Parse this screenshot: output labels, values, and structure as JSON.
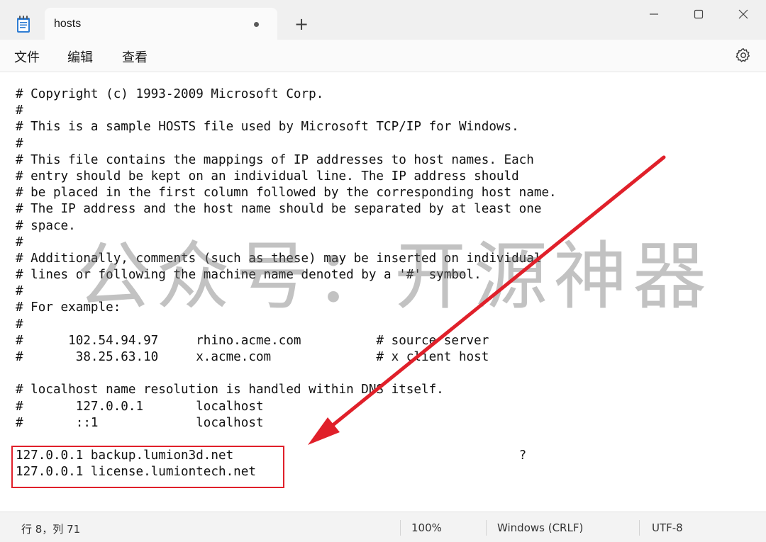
{
  "window": {
    "tab_title": "hosts",
    "new_tab_symbol": "+",
    "app_icon": "notepad-icon",
    "controls": [
      "minimize-icon",
      "maximize-icon",
      "close-icon"
    ]
  },
  "menu": {
    "file": "文件",
    "edit": "编辑",
    "view": "查看",
    "settings_icon": "gear-icon"
  },
  "editor": {
    "lines": [
      "# Copyright (c) 1993-2009 Microsoft Corp.",
      "#",
      "# This is a sample HOSTS file used by Microsoft TCP/IP for Windows.",
      "#",
      "# This file contains the mappings of IP addresses to host names. Each",
      "# entry should be kept on an individual line. The IP address should",
      "# be placed in the first column followed by the corresponding host name.",
      "# The IP address and the host name should be separated by at least one",
      "# space.",
      "#",
      "# Additionally, comments (such as these) may be inserted on individual",
      "# lines or following the machine name denoted by a '#' symbol.",
      "#",
      "# For example:",
      "#",
      "#      102.54.94.97     rhino.acme.com          # source server",
      "#       38.25.63.10     x.acme.com              # x client host",
      "",
      "# localhost name resolution is handled within DNS itself.",
      "#       127.0.0.1       localhost",
      "#       ::1             localhost",
      "",
      "127.0.0.1 backup.lumion3d.net                                      ?",
      "127.0.0.1 license.lumiontech.net"
    ],
    "watermark": "公众号：开源神器",
    "annotation_color": "#e0202a"
  },
  "status": {
    "position": "行 8，列 71",
    "zoom": "100%",
    "line_ending": "Windows (CRLF)",
    "encoding": "UTF-8"
  }
}
